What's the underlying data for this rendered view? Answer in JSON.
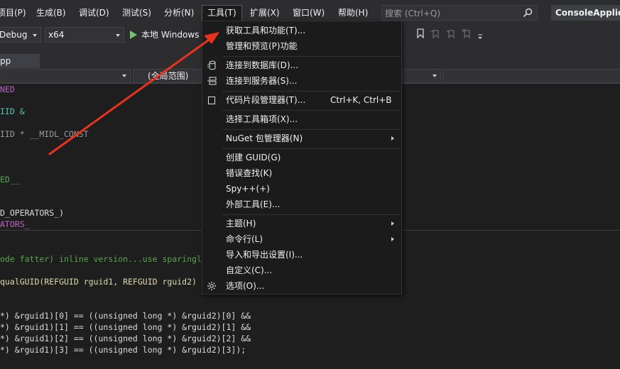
{
  "menubar": {
    "items": [
      {
        "label": "项目(P)"
      },
      {
        "label": "生成(B)"
      },
      {
        "label": "调试(D)"
      },
      {
        "label": "测试(S)"
      },
      {
        "label": "分析(N)"
      },
      {
        "label": "工具(T)"
      },
      {
        "label": "扩展(X)"
      },
      {
        "label": "窗口(W)"
      },
      {
        "label": "帮助(H)"
      }
    ],
    "search_placeholder": "搜索 (Ctrl+Q)",
    "app_title": "ConsoleApplica"
  },
  "toolbar": {
    "config": "Debug",
    "platform": "x64",
    "run_label": "本地 Windows"
  },
  "tabs": {
    "file_tab": "pp"
  },
  "navbar": {
    "scope": "(全局范围)"
  },
  "code": {
    "lines": [
      "NED",
      "IID &",
      "IID * __MIDL_CONST",
      "ED__",
      "D_OPERATORS_)",
      "ATORS_",
      "ode fatter) inline version...use sparingl",
      "qualGUID(REFGUID rguid1, REFGUID rguid2)",
      "*) &rguid1)[0] == ((unsigned long *) &rguid2)[0] &&",
      "*) &rguid1)[1] == ((unsigned long *) &rguid2)[1] &&",
      "*) &rguid1)[2] == ((unsigned long *) &rguid2)[2] &&",
      "*) &rguid1)[3] == ((unsigned long *) &rguid2)[3]);"
    ]
  },
  "tools_menu": {
    "items": [
      {
        "label": "获取工具和功能(T)...",
        "icon": ""
      },
      {
        "label": "管理和预览(P)功能",
        "icon": ""
      },
      {
        "label": "连接到数据库(D)...",
        "icon": "database-connect-icon"
      },
      {
        "label": "连接到服务器(S)...",
        "icon": "server-connect-icon"
      },
      {
        "label": "代码片段管理器(T)...",
        "shortcut": "Ctrl+K, Ctrl+B",
        "icon": "snippet-box-icon"
      },
      {
        "label": "选择工具箱项(X)...",
        "icon": ""
      },
      {
        "label": "NuGet 包管理器(N)",
        "icon": "",
        "submenu": true
      },
      {
        "label": "创建 GUID(G)",
        "icon": ""
      },
      {
        "label": "错误查找(K)",
        "icon": ""
      },
      {
        "label": "Spy++(+)",
        "icon": ""
      },
      {
        "label": "外部工具(E)...",
        "icon": ""
      },
      {
        "label": "主题(H)",
        "icon": "",
        "submenu": true
      },
      {
        "label": "命令行(L)",
        "icon": "",
        "submenu": true
      },
      {
        "label": "导入和导出设置(I)...",
        "icon": ""
      },
      {
        "label": "自定义(C)...",
        "icon": ""
      },
      {
        "label": "选项(O)...",
        "icon": "gear-icon"
      }
    ]
  },
  "colors": {
    "menubar_bg": "#2d2d30",
    "dropdown_bg": "#1b1b1c",
    "editor_bg": "#1e1e1e",
    "keyword": "#569cd6",
    "arrow": "#e8321e"
  }
}
